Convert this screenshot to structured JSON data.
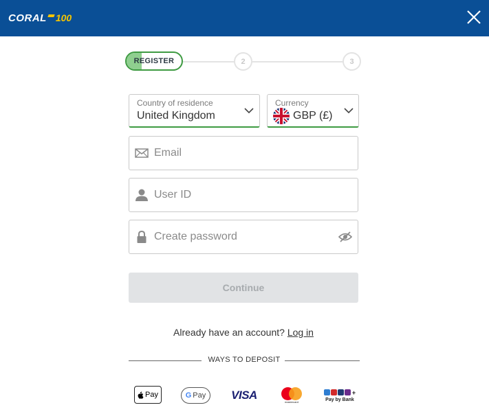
{
  "header": {
    "logo_text": "CORAL",
    "logo_anniversary": "100",
    "close_icon": "close-icon",
    "background": "#0a4f96"
  },
  "stepper": {
    "active_label": "REGISTER",
    "step2": "2",
    "step3": "3",
    "progress_fraction": 0.25,
    "accent": "#3d9a41"
  },
  "country": {
    "label": "Country of residence",
    "value": "United Kingdom"
  },
  "currency": {
    "label": "Currency",
    "value": "GBP (£)",
    "flag_icon": "uk-flag-icon"
  },
  "fields": {
    "email_placeholder": "Email",
    "userid_placeholder": "User ID",
    "password_placeholder": "Create password"
  },
  "continue_label": "Continue",
  "login": {
    "prompt": "Already have an account?",
    "link": "Log in"
  },
  "deposit": {
    "heading": "WAYS TO DEPOSIT",
    "methods": {
      "apple_pay": "Pay",
      "google_pay_g": "G",
      "google_pay": "Pay",
      "visa": "VISA",
      "mastercard": "mastercard",
      "pay_by_bank": "Pay by Bank"
    }
  }
}
